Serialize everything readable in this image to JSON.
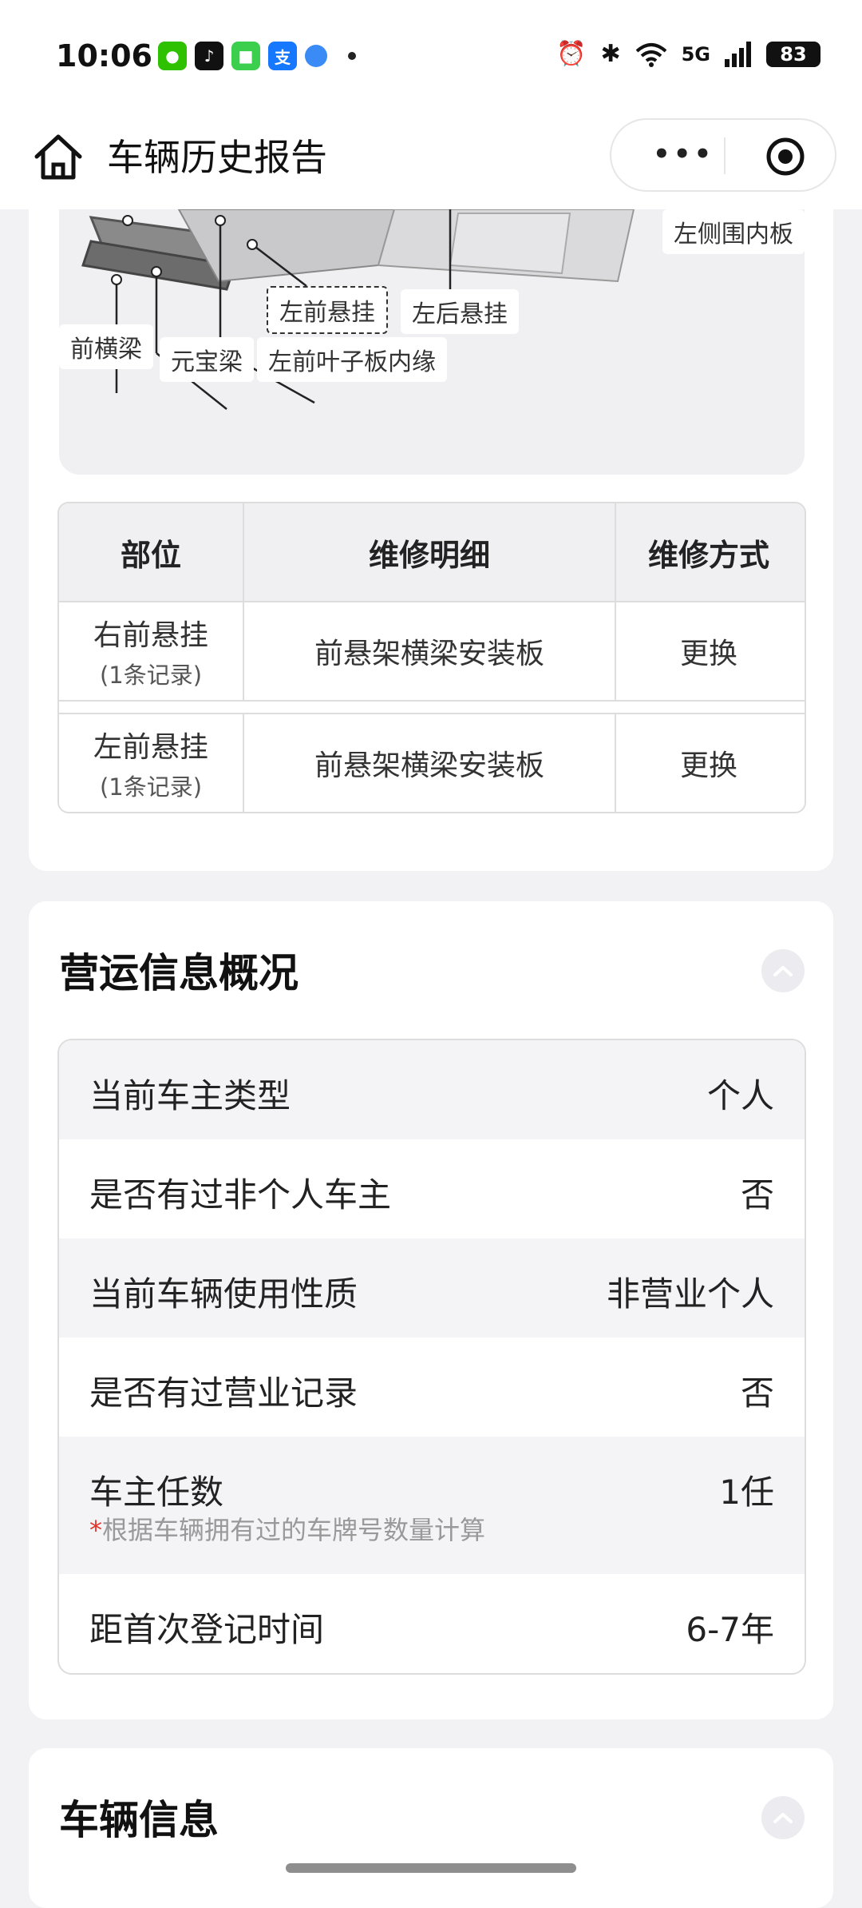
{
  "status_bar": {
    "time": "10:06",
    "network": "5G",
    "battery": "83",
    "app_icons": [
      "wechat-icon",
      "tiktok-icon",
      "shopping-icon",
      "alipay-icon",
      "browser-icon"
    ]
  },
  "nav": {
    "title": "车辆历史报告"
  },
  "diagram": {
    "labels": [
      "左侧围内板",
      "左前悬挂",
      "左后悬挂",
      "前横梁",
      "元宝梁",
      "左前叶子板内缘"
    ]
  },
  "repair_table": {
    "headers": [
      "部位",
      "维修明细",
      "维修方式"
    ],
    "rows": [
      {
        "part": "右前悬挂",
        "count": "(1条记录)",
        "detail": "前悬架横梁安装板",
        "method": "更换"
      },
      {
        "part": "左前悬挂",
        "count": "(1条记录)",
        "detail": "前悬架横梁安装板",
        "method": "更换"
      }
    ]
  },
  "operation": {
    "title": "营运信息概况",
    "rows": [
      {
        "label": "当前车主类型",
        "value": "个人"
      },
      {
        "label": "是否有过非个人车主",
        "value": "否"
      },
      {
        "label": "当前车辆使用性质",
        "value": "非营业个人"
      },
      {
        "label": "是否有过营业记录",
        "value": "否"
      },
      {
        "label": "车主任数",
        "value": "1任",
        "note_star": "*",
        "note": "根据车辆拥有过的车牌号数量计算"
      },
      {
        "label": "距首次登记时间",
        "value": "6-7年"
      }
    ]
  },
  "vehicle": {
    "title": "车辆信息"
  },
  "colors": {
    "accent_red": "#e0342a",
    "card_bg": "#ffffff",
    "page_bg": "#f2f2f4"
  }
}
